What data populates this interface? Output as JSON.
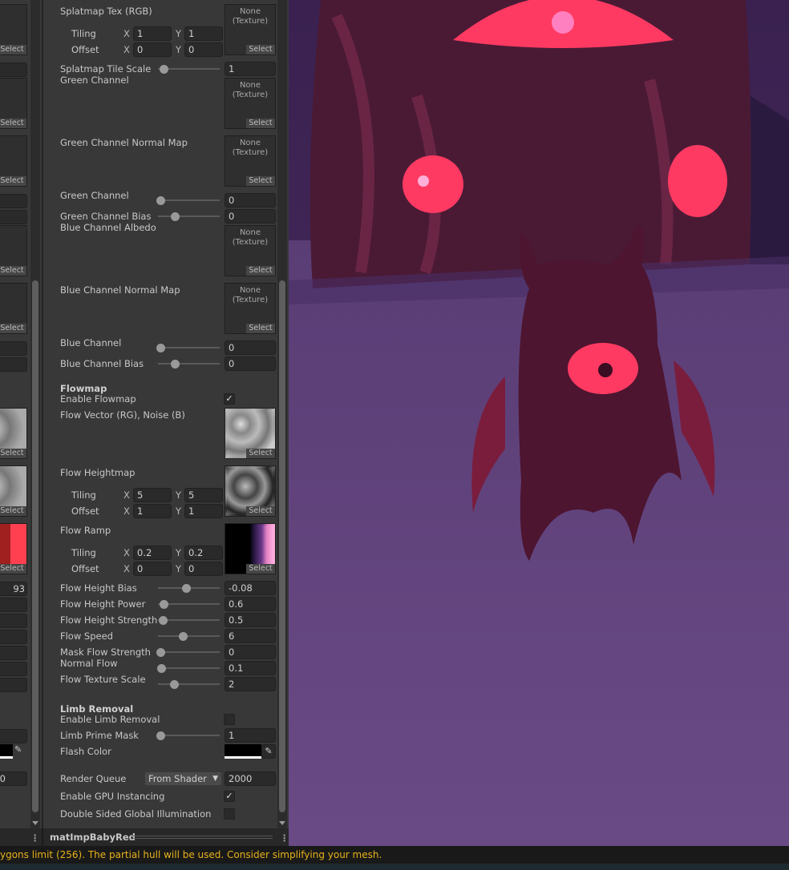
{
  "inspector": {
    "select_label": "Select",
    "texture_none": [
      "None",
      "(Texture)"
    ],
    "x_label": "X",
    "y_label": "Y",
    "rows": [
      {
        "type": "texture",
        "label": "Splatmap Tex (RGB)",
        "tex": "none"
      },
      {
        "type": "vec",
        "label": "Tiling",
        "x": "1",
        "y": "1"
      },
      {
        "type": "vec",
        "label": "Offset",
        "x": "0",
        "y": "0"
      },
      {
        "type": "slider",
        "label": "Splatmap Tile Scale",
        "value": "1",
        "pos": 0.05
      },
      {
        "type": "texture",
        "label": "Green Channel Albedo (RGB) Specular Scale (A)",
        "tex": "none",
        "clip": true
      },
      {
        "type": "texture",
        "label": "Green Channel Normal Map",
        "tex": "none"
      },
      {
        "type": "slider",
        "label": "Green Channel Smoothness",
        "value": "0",
        "pos": 0.0,
        "clip": true
      },
      {
        "type": "slider",
        "label": "Green Channel Bias",
        "value": "0",
        "pos": 0.25
      },
      {
        "type": "texture",
        "label": "Blue Channel Albedo  Specular Scale (A)",
        "tex": "none",
        "clip": true
      },
      {
        "type": "texture",
        "label": "Blue Channel Normal Map",
        "tex": "none"
      },
      {
        "type": "slider",
        "label": "Blue Channel Smoothness",
        "value": "0",
        "pos": 0.0,
        "clip": true
      },
      {
        "type": "slider",
        "label": "Blue Channel Bias",
        "value": "0",
        "pos": 0.25
      },
      {
        "type": "header",
        "label": "Flowmap"
      },
      {
        "type": "toggle",
        "label": "Enable Flowmap",
        "checked": true
      },
      {
        "type": "texture",
        "label": "Flow Vector (RG), Noise (B)",
        "tex": "noise"
      },
      {
        "type": "texture",
        "label": "Flow Heightmap",
        "tex": "clouds"
      },
      {
        "type": "vec",
        "label": "Tiling",
        "x": "5",
        "y": "5"
      },
      {
        "type": "vec",
        "label": "Offset",
        "x": "1",
        "y": "1"
      },
      {
        "type": "texture",
        "label": "Flow Ramp",
        "tex": "ramp"
      },
      {
        "type": "vec",
        "label": "Tiling",
        "x": "0.2",
        "y": "0.2"
      },
      {
        "type": "vec",
        "label": "Offset",
        "x": "0",
        "y": "0"
      },
      {
        "type": "slider",
        "label": "Flow Height Bias",
        "value": "-0.08",
        "pos": 0.46
      },
      {
        "type": "slider",
        "label": "Flow Height Power",
        "value": "0.6",
        "pos": 0.06
      },
      {
        "type": "slider",
        "label": "Flow Height Strength",
        "value": "0.5",
        "pos": 0.04
      },
      {
        "type": "slider",
        "label": "Flow Speed",
        "value": "6",
        "pos": 0.4
      },
      {
        "type": "slider",
        "label": "Mask Flow Strength",
        "value": "0",
        "pos": 0.0
      },
      {
        "type": "slider",
        "label": "Normal Flow Strength",
        "value": "0.1",
        "pos": 0.02,
        "clip": true
      },
      {
        "type": "slider",
        "label": "Flow Texture Scale Factor",
        "value": "2",
        "pos": 0.24,
        "clip": true
      },
      {
        "type": "header",
        "label": "Limb Removal"
      },
      {
        "type": "toggle",
        "label": "Enable Limb Removal",
        "checked": false
      },
      {
        "type": "slider",
        "label": "Limb Prime Mask",
        "value": "1",
        "pos": 0.0
      },
      {
        "type": "color",
        "label": "Flash Color",
        "color": "#000000"
      },
      {
        "type": "queue",
        "label": "Render Queue",
        "dropdown": "From Shader",
        "value": "2000"
      },
      {
        "type": "toggle",
        "label": "Enable GPU Instancing",
        "checked": true
      },
      {
        "type": "toggle",
        "label": "Double Sided Global Illumination",
        "checked": false
      }
    ]
  },
  "left_panel": {
    "values": [
      "93",
      "0"
    ]
  },
  "footer": {
    "material_name": "matImpBabyRed"
  },
  "status": {
    "message": "ygons limit (256). The partial hull will be used. Consider simplifying your mesh."
  },
  "colors": {
    "accent_warning": "#e7b21b",
    "panel_bg": "#383838"
  }
}
